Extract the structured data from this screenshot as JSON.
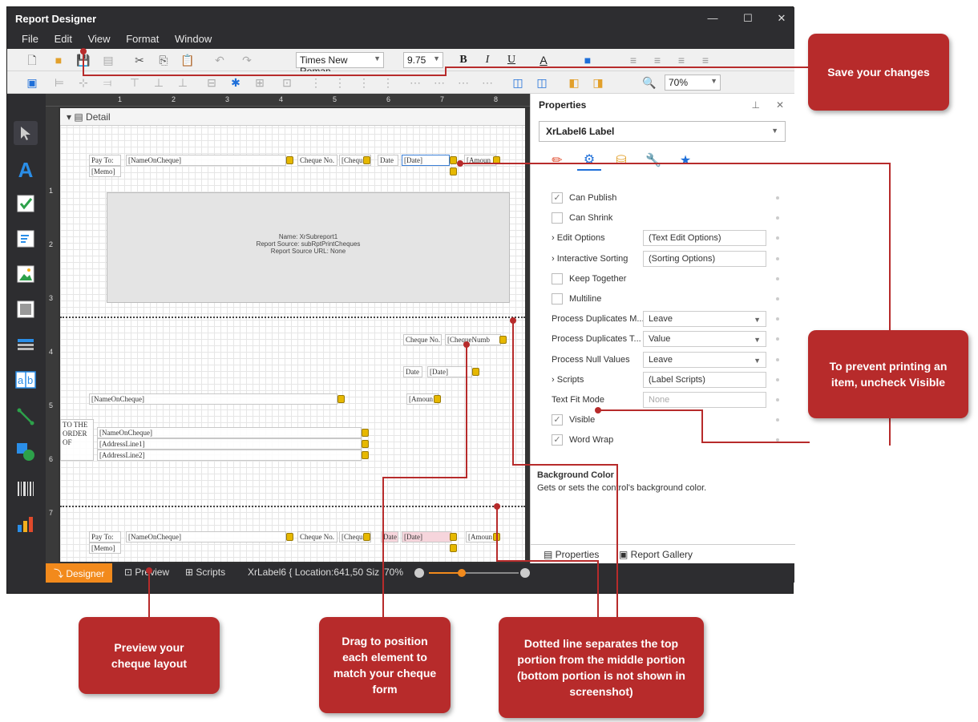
{
  "app": {
    "title": "Report Designer"
  },
  "window_controls": {
    "minimize": "—",
    "maximize": "☐",
    "close": "✕"
  },
  "menu": [
    "File",
    "Edit",
    "View",
    "Format",
    "Window"
  ],
  "toolbar": {
    "font": "Times New Roman",
    "size": "9.75",
    "bold": "B",
    "italic": "I",
    "underline": "U",
    "zoom": "70%"
  },
  "ruler": {
    "h": [
      "1",
      "2",
      "3",
      "4",
      "5",
      "6",
      "7",
      "8"
    ],
    "v": [
      "1",
      "2",
      "3",
      "4",
      "5",
      "6",
      "7"
    ]
  },
  "band": {
    "label": "Detail"
  },
  "canvas": {
    "pay_to": "Pay To:",
    "name_on_cheque": "[NameOnCheque]",
    "cheque_no": "Cheque No.",
    "cheque_field": "[Chequ",
    "date": "Date",
    "date_field": "[Date]",
    "amount": "[Amoun",
    "memo": "[Memo]",
    "sub_name": "Name: XrSubreport1",
    "sub_source": "Report Source: subRptPrintCheques",
    "sub_url": "Report Source URL: None",
    "cheque_num2": "[ChequeNumb",
    "to_the_order": "TO THE ORDER OF",
    "address1": "[AddressLine1]",
    "address2": "[AddressLine2]"
  },
  "properties": {
    "title": "Properties",
    "selected": "XrLabel6  Label",
    "rows": [
      {
        "name": "Can Publish",
        "check": true
      },
      {
        "name": "Can Shrink",
        "check": false
      },
      {
        "name": "Edit Options",
        "value": "(Text Edit Options)",
        "expand": true
      },
      {
        "name": "Interactive Sorting",
        "value": "(Sorting Options)",
        "expand": true
      },
      {
        "name": "Keep Together",
        "check": false
      },
      {
        "name": "Multiline",
        "check": false
      },
      {
        "name": "Process Duplicates M...",
        "value": "Leave",
        "dropdown": true
      },
      {
        "name": "Process Duplicates T...",
        "value": "Value",
        "dropdown": true
      },
      {
        "name": "Process Null Values",
        "value": "Leave",
        "dropdown": true
      },
      {
        "name": "Scripts",
        "value": "(Label Scripts)",
        "expand": true
      },
      {
        "name": "Text Fit Mode",
        "value": "None"
      },
      {
        "name": "Visible",
        "check": true
      },
      {
        "name": "Word Wrap",
        "check": true
      }
    ],
    "desc_title": "Background Color",
    "desc_text": "Gets or sets the control's background color.",
    "tab_properties": "Properties",
    "tab_gallery": "Report Gallery"
  },
  "status": {
    "designer": "Designer",
    "preview": "Preview",
    "scripts": "Scripts",
    "location": "XrLabel6 { Location:641,50 Siz",
    "zoom": "70%"
  },
  "callouts": {
    "save": "Save your changes",
    "visible": "To prevent printing an item, uncheck Visible",
    "preview": "Preview your cheque layout",
    "drag": "Drag to position each element to match your cheque form",
    "dotted": "Dotted line separates the top portion from the middle portion (bottom portion is not shown in screenshot)"
  },
  "colors": {
    "accent_orange": "#f28a1c",
    "callout_red": "#b72b2b",
    "dark_chrome": "#2d2d30"
  }
}
